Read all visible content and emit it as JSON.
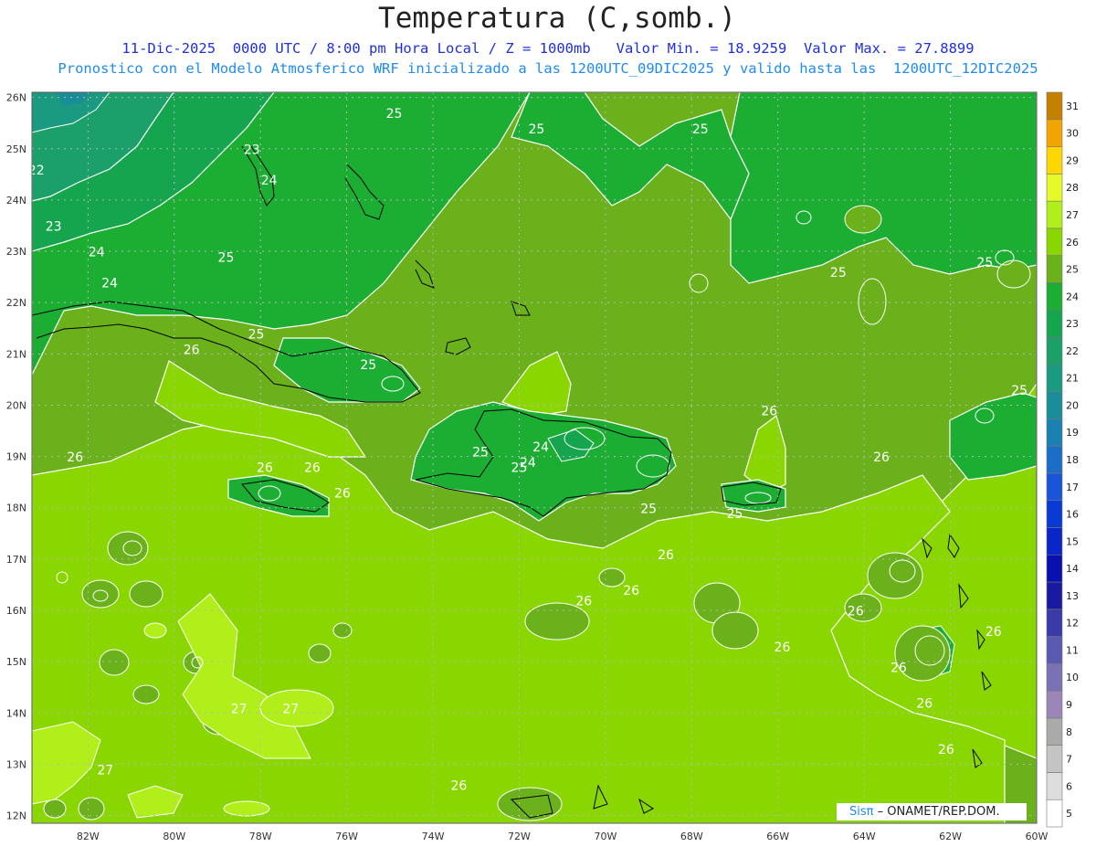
{
  "title": "Temperatura (C,somb.)",
  "subtitle_line1": "11-Dic-2025  0000 UTC / 8:00 pm Hora Local / Z = 1000mb   Valor Min. = 18.9259  Valor Max. = 27.8899",
  "subtitle_line2": "Pronostico con el Modelo Atmosferico WRF inicializado a las 1200UTC_09DIC2025 y valido hasta las  1200UTC_12DIC2025",
  "credit_brand": "Sisπ",
  "credit_text": " – ONAMET/REP.DOM.",
  "lat_labels": [
    "26N",
    "25N",
    "24N",
    "23N",
    "22N",
    "21N",
    "20N",
    "19N",
    "18N",
    "17N",
    "16N",
    "15N",
    "14N",
    "13N",
    "12N"
  ],
  "lon_labels": [
    "82W",
    "80W",
    "78W",
    "76W",
    "74W",
    "72W",
    "70W",
    "68W",
    "66W",
    "64W",
    "62W",
    "60W"
  ],
  "colorbar": [
    {
      "label": "5",
      "color": "#ffffff"
    },
    {
      "label": "6",
      "color": "#dddddd"
    },
    {
      "label": "7",
      "color": "#c4c4c4"
    },
    {
      "label": "8",
      "color": "#aaaaaa"
    },
    {
      "label": "9",
      "color": "#9a87b8"
    },
    {
      "label": "10",
      "color": "#7a72b4"
    },
    {
      "label": "11",
      "color": "#5a5ab0"
    },
    {
      "label": "12",
      "color": "#3a3aa8"
    },
    {
      "label": "13",
      "color": "#1a1aa0"
    },
    {
      "label": "14",
      "color": "#0a10b0"
    },
    {
      "label": "15",
      "color": "#0a26c8"
    },
    {
      "label": "16",
      "color": "#0a3ad6"
    },
    {
      "label": "17",
      "color": "#1a55d8"
    },
    {
      "label": "18",
      "color": "#1a6ec8"
    },
    {
      "label": "19",
      "color": "#1a82b0"
    },
    {
      "label": "20",
      "color": "#1a8e98"
    },
    {
      "label": "21",
      "color": "#1a9a80"
    },
    {
      "label": "22",
      "color": "#1aa068"
    },
    {
      "label": "23",
      "color": "#15a54e"
    },
    {
      "label": "24",
      "color": "#1cae33"
    },
    {
      "label": "25",
      "color": "#6ab11c"
    },
    {
      "label": "26",
      "color": "#8ad600"
    },
    {
      "label": "27",
      "color": "#b0ef1a"
    },
    {
      "label": "28",
      "color": "#e6fa2a"
    },
    {
      "label": "29",
      "color": "#ffd600"
    },
    {
      "label": "30",
      "color": "#f2a500"
    },
    {
      "label": "31",
      "color": "#c58000"
    }
  ],
  "contour_labels": [
    {
      "text": "22",
      "lon": -83.2,
      "lat": 24.5
    },
    {
      "text": "23",
      "lon": -82.8,
      "lat": 23.4
    },
    {
      "text": "23",
      "lon": -78.2,
      "lat": 24.9
    },
    {
      "text": "24",
      "lon": -77.8,
      "lat": 24.3
    },
    {
      "text": "24",
      "lon": -81.8,
      "lat": 22.9
    },
    {
      "text": "24",
      "lon": -81.5,
      "lat": 22.3
    },
    {
      "text": "25",
      "lon": -78.8,
      "lat": 22.8
    },
    {
      "text": "25",
      "lon": -74.9,
      "lat": 25.6
    },
    {
      "text": "25",
      "lon": -71.6,
      "lat": 25.3
    },
    {
      "text": "25",
      "lon": -67.8,
      "lat": 25.3
    },
    {
      "text": "25",
      "lon": -64.6,
      "lat": 22.5
    },
    {
      "text": "25",
      "lon": -61.2,
      "lat": 22.7
    },
    {
      "text": "25",
      "lon": -60.4,
      "lat": 20.2
    },
    {
      "text": "25",
      "lon": -78.1,
      "lat": 21.3
    },
    {
      "text": "25",
      "lon": -75.5,
      "lat": 20.7
    },
    {
      "text": "25",
      "lon": -72.9,
      "lat": 19.0
    },
    {
      "text": "25",
      "lon": -72.0,
      "lat": 18.7
    },
    {
      "text": "25",
      "lon": -69.0,
      "lat": 17.9
    },
    {
      "text": "25",
      "lon": -67.0,
      "lat": 17.8
    },
    {
      "text": "24",
      "lon": -71.5,
      "lat": 19.1
    },
    {
      "text": "24",
      "lon": -71.8,
      "lat": 18.8
    },
    {
      "text": "26",
      "lon": -79.6,
      "lat": 21.0
    },
    {
      "text": "26",
      "lon": -82.3,
      "lat": 18.9
    },
    {
      "text": "26",
      "lon": -77.9,
      "lat": 18.7
    },
    {
      "text": "26",
      "lon": -76.8,
      "lat": 18.7
    },
    {
      "text": "26",
      "lon": -76.1,
      "lat": 18.2
    },
    {
      "text": "26",
      "lon": -66.2,
      "lat": 19.8
    },
    {
      "text": "26",
      "lon": -63.6,
      "lat": 18.9
    },
    {
      "text": "26",
      "lon": -68.6,
      "lat": 17.0
    },
    {
      "text": "26",
      "lon": -70.5,
      "lat": 16.1
    },
    {
      "text": "26",
      "lon": -69.4,
      "lat": 16.3
    },
    {
      "text": "26",
      "lon": -64.2,
      "lat": 15.9
    },
    {
      "text": "26",
      "lon": -65.9,
      "lat": 15.2
    },
    {
      "text": "26",
      "lon": -63.2,
      "lat": 14.8
    },
    {
      "text": "26",
      "lon": -62.6,
      "lat": 14.1
    },
    {
      "text": "26",
      "lon": -61.0,
      "lat": 15.5
    },
    {
      "text": "26",
      "lon": -62.1,
      "lat": 13.2
    },
    {
      "text": "26",
      "lon": -73.4,
      "lat": 12.5
    },
    {
      "text": "27",
      "lon": -78.5,
      "lat": 14.0
    },
    {
      "text": "27",
      "lon": -77.3,
      "lat": 14.0
    },
    {
      "text": "27",
      "lon": -81.6,
      "lat": 12.8
    }
  ]
}
